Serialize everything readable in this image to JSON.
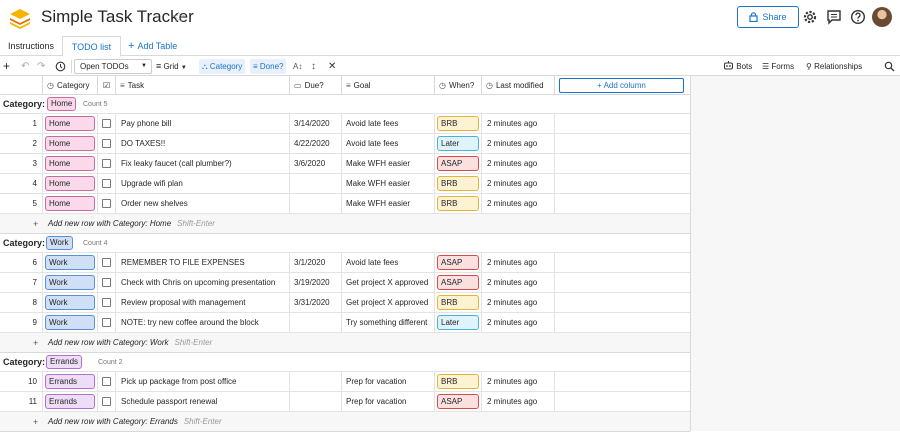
{
  "app": {
    "title": "Simple Task Tracker",
    "share_label": "Share"
  },
  "page_tabs": {
    "instructions": "Instructions",
    "todo": "TODO list",
    "add_table": "Add Table"
  },
  "toolbar": {
    "view_name": "Open TODOs",
    "grid_label": "Grid",
    "group_chip": "Category",
    "filter_chip": "Done?",
    "bots": "Bots",
    "forms": "Forms",
    "relationships": "Relationships"
  },
  "columns": {
    "category": "Category",
    "task": "Task",
    "due": "Due?",
    "goal": "Goal",
    "when": "When?",
    "modified": "Last modified",
    "add_column": "Add column"
  },
  "groups": [
    {
      "label": "Category:",
      "name": "Home",
      "count": "Count 5",
      "add_row": "Add new row with Category: Home",
      "shortcut": "Shift-Enter",
      "rows": [
        {
          "id": "1",
          "category": "Home",
          "task": "Pay phone bill",
          "due": "3/14/2020",
          "goal": "Avoid late fees",
          "when": "BRB",
          "modified": "2 minutes ago"
        },
        {
          "id": "2",
          "category": "Home",
          "task": "DO TAXES!!",
          "due": "4/22/2020",
          "goal": "Avoid late fees",
          "when": "Later",
          "modified": "2 minutes ago"
        },
        {
          "id": "3",
          "category": "Home",
          "task": "Fix leaky faucet (call plumber?)",
          "due": "3/6/2020",
          "goal": "Make WFH easier",
          "when": "ASAP",
          "modified": "2 minutes ago"
        },
        {
          "id": "4",
          "category": "Home",
          "task": "Upgrade wifi plan",
          "due": "",
          "goal": "Make WFH easier",
          "when": "BRB",
          "modified": "2 minutes ago"
        },
        {
          "id": "5",
          "category": "Home",
          "task": "Order new shelves",
          "due": "",
          "goal": "Make WFH easier",
          "when": "BRB",
          "modified": "2 minutes ago"
        }
      ]
    },
    {
      "label": "Category:",
      "name": "Work",
      "count": "Count 4",
      "add_row": "Add new row with Category: Work",
      "shortcut": "Shift-Enter",
      "rows": [
        {
          "id": "6",
          "category": "Work",
          "task": "REMEMBER TO FILE EXPENSES",
          "due": "3/1/2020",
          "goal": "Avoid late fees",
          "when": "ASAP",
          "modified": "2 minutes ago"
        },
        {
          "id": "7",
          "category": "Work",
          "task": "Check with Chris on upcoming presentation",
          "due": "3/19/2020",
          "goal": "Get project X approved",
          "when": "ASAP",
          "modified": "2 minutes ago"
        },
        {
          "id": "8",
          "category": "Work",
          "task": "Review proposal with management",
          "due": "3/31/2020",
          "goal": "Get project X approved",
          "when": "BRB",
          "modified": "2 minutes ago"
        },
        {
          "id": "9",
          "category": "Work",
          "task": "NOTE: try new coffee around the block",
          "due": "",
          "goal": "Try something different",
          "when": "Later",
          "modified": "2 minutes ago"
        }
      ]
    },
    {
      "label": "Category:",
      "name": "Errands",
      "count": "Count 2",
      "add_row": "Add new row with Category: Errands",
      "shortcut": "Shift-Enter",
      "rows": [
        {
          "id": "10",
          "category": "Errands",
          "task": "Pick up package from post office",
          "due": "",
          "goal": "Prep for vacation",
          "when": "BRB",
          "modified": "2 minutes ago"
        },
        {
          "id": "11",
          "category": "Errands",
          "task": "Schedule passport renewal",
          "due": "",
          "goal": "Prep for vacation",
          "when": "ASAP",
          "modified": "2 minutes ago"
        }
      ]
    }
  ],
  "colors": {
    "accent": "#1a73c8",
    "home": "#f9d9ea",
    "work": "#cfe0f6",
    "errands": "#eeddf6",
    "brb": "#fdf3d2",
    "later": "#dff3fa",
    "asap": "#fbe0e0"
  }
}
